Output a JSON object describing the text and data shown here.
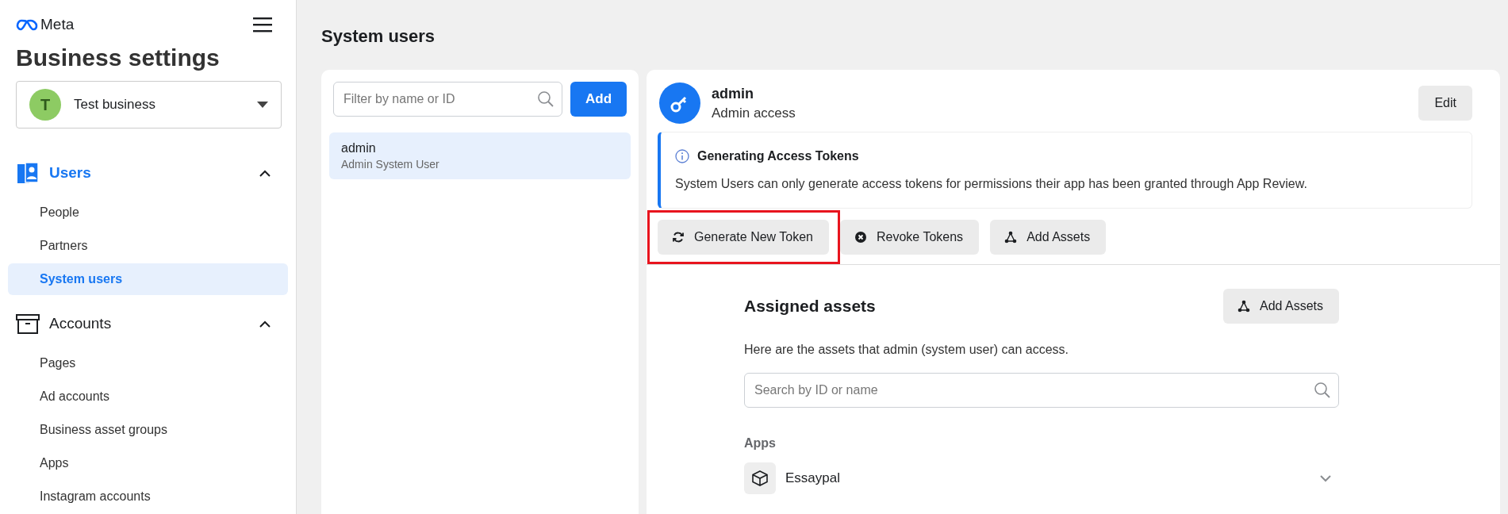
{
  "sidebar": {
    "logo": "Meta",
    "title": "Business settings",
    "business": {
      "initial": "T",
      "name": "Test business"
    },
    "sections": [
      {
        "kind": "users",
        "label": "Users",
        "expanded": true,
        "selected": true,
        "items": [
          {
            "label": "People",
            "selected": false
          },
          {
            "label": "Partners",
            "selected": false
          },
          {
            "label": "System users",
            "selected": true
          }
        ]
      },
      {
        "kind": "accounts",
        "label": "Accounts",
        "expanded": true,
        "selected": false,
        "items": [
          {
            "label": "Pages",
            "selected": false
          },
          {
            "label": "Ad accounts",
            "selected": false
          },
          {
            "label": "Business asset groups",
            "selected": false
          },
          {
            "label": "Apps",
            "selected": false
          },
          {
            "label": "Instagram accounts",
            "selected": false
          }
        ]
      }
    ]
  },
  "page_title": "System users",
  "user_list": {
    "filter": {
      "placeholder": "Filter by name or ID"
    },
    "add_button": "Add",
    "users": [
      {
        "name": "admin",
        "role": "Admin System User",
        "selected": true
      }
    ]
  },
  "detail": {
    "name": "admin",
    "access": "Admin access",
    "edit_button": "Edit",
    "notice": {
      "title": "Generating Access Tokens",
      "text": "System Users can only generate access tokens for permissions their app has been granted through App Review."
    },
    "actions": [
      {
        "kind": "refresh",
        "label": "Generate New Token",
        "highlighted": true
      },
      {
        "kind": "revoke",
        "label": "Revoke Tokens",
        "highlighted": false
      },
      {
        "kind": "assets",
        "label": "Add Assets",
        "highlighted": false
      }
    ],
    "assigned": {
      "title": "Assigned assets",
      "add_button": "Add Assets",
      "description": "Here are the assets that admin (system user) can access.",
      "search": {
        "placeholder": "Search by ID or name"
      },
      "groups": [
        {
          "label": "Apps",
          "items": [
            {
              "name": "Essaypal",
              "expanded": false
            }
          ]
        }
      ]
    }
  }
}
